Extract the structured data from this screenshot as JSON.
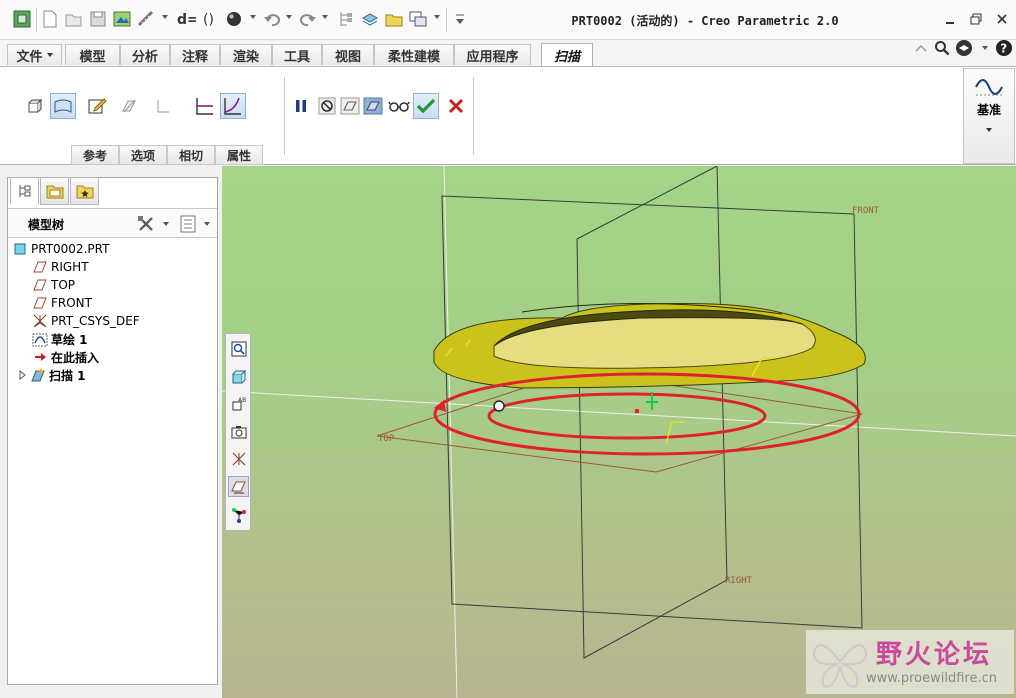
{
  "window": {
    "title": "PRT0002 (活动的) - Creo Parametric 2.0"
  },
  "menu": {
    "tabs": [
      {
        "label": "文件"
      },
      {
        "label": "模型"
      },
      {
        "label": "分析"
      },
      {
        "label": "注释"
      },
      {
        "label": "渲染"
      },
      {
        "label": "工具"
      },
      {
        "label": "视图"
      },
      {
        "label": "柔性建模"
      },
      {
        "label": "应用程序"
      },
      {
        "label": "扫描",
        "active": true
      }
    ]
  },
  "ribbon": {
    "subtabs": [
      {
        "label": "参考"
      },
      {
        "label": "选项"
      },
      {
        "label": "相切"
      },
      {
        "label": "属性"
      }
    ],
    "datum_label": "基准"
  },
  "model_tree": {
    "title": "模型树",
    "items": [
      {
        "label": "PRT0002.PRT",
        "icon": "part-icon"
      },
      {
        "label": "RIGHT",
        "icon": "datum-plane-icon"
      },
      {
        "label": "TOP",
        "icon": "datum-plane-icon"
      },
      {
        "label": "FRONT",
        "icon": "datum-plane-icon"
      },
      {
        "label": "PRT_CSYS_DEF",
        "icon": "csys-icon"
      },
      {
        "label": "草绘 1",
        "icon": "sketch-icon"
      },
      {
        "label": "在此插入",
        "icon": "insert-here-arrow-icon"
      },
      {
        "label": "扫描 1",
        "icon": "sweep-icon"
      }
    ]
  },
  "graphics": {
    "datum_labels": {
      "front": "FRONT",
      "top": "TOP",
      "right": "RIGHT"
    },
    "colors": {
      "background_top": "#a3d488",
      "background_bottom": "#b7b48f",
      "sweep_surface": "#c8c31a",
      "trajectory": "#e0202a",
      "datum_plane": "#3a3a3a"
    }
  },
  "watermark": {
    "title": "野火论坛",
    "url": "www.proewildfire.cn"
  }
}
